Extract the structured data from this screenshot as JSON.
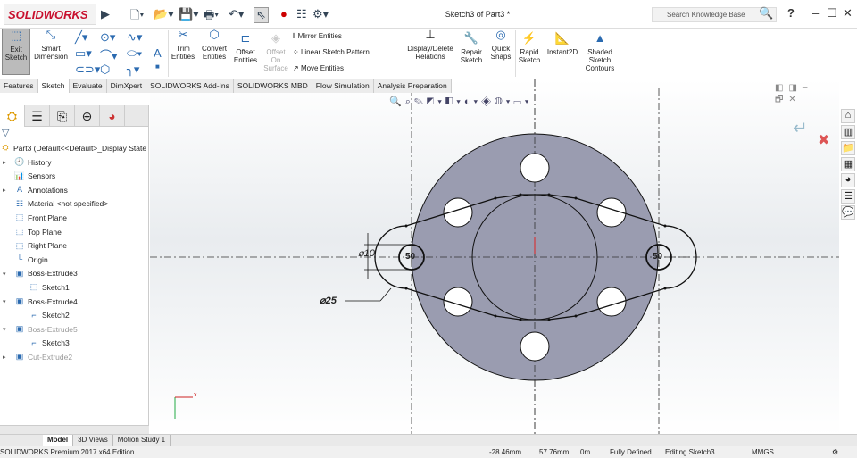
{
  "app": {
    "logo": "SOLIDWORKS",
    "title": "Sketch3 of Part3 *",
    "search_placeholder": "Search Knowledge Base",
    "help": "?"
  },
  "ribbon": {
    "exit_sketch": "Exit Sketch",
    "smart_dimension": "Smart Dimension",
    "trim": "Trim Entities",
    "convert": "Convert Entities",
    "offset": "Offset Entities",
    "offset_surface": "Offset On Surface",
    "mirror": "Mirror Entities",
    "linear_pattern": "Linear Sketch Pattern",
    "move": "Move Entities",
    "display_relations": "Display/Delete Relations",
    "repair": "Repair Sketch",
    "quick_snaps": "Quick Snaps",
    "rapid_sketch": "Rapid Sketch",
    "instant2d": "Instant2D",
    "shaded": "Shaded Sketch Contours"
  },
  "tabs": [
    "Features",
    "Sketch",
    "Evaluate",
    "DimXpert",
    "SOLIDWORKS Add-Ins",
    "SOLIDWORKS MBD",
    "Flow Simulation",
    "Analysis Preparation"
  ],
  "active_tab": "Sketch",
  "tree": {
    "root": "Part3  (Default<<Default>_Display State",
    "items": [
      "History",
      "Sensors",
      "Annotations",
      "Material <not specified>",
      "Front Plane",
      "Top Plane",
      "Right Plane",
      "Origin",
      "Boss-Extrude3",
      "Sketch1",
      "Boss-Extrude4",
      "Sketch2",
      "Boss-Extrude5",
      "Sketch3",
      "Cut-Extrude2"
    ]
  },
  "sketch": {
    "dim_small": "⌀10",
    "dim_large": "⌀25",
    "left_label": "50",
    "right_label": "50",
    "face_color": "#9a9cb0"
  },
  "bottom_tabs": [
    "Model",
    "3D Views",
    "Motion Study 1"
  ],
  "status": {
    "edition": "SOLIDWORKS Premium 2017 x64 Edition",
    "x": "-28.46mm",
    "y": "57.76mm",
    "z": "0m",
    "state": "Fully Defined",
    "mode": "Editing Sketch3",
    "units": "MMGS"
  }
}
